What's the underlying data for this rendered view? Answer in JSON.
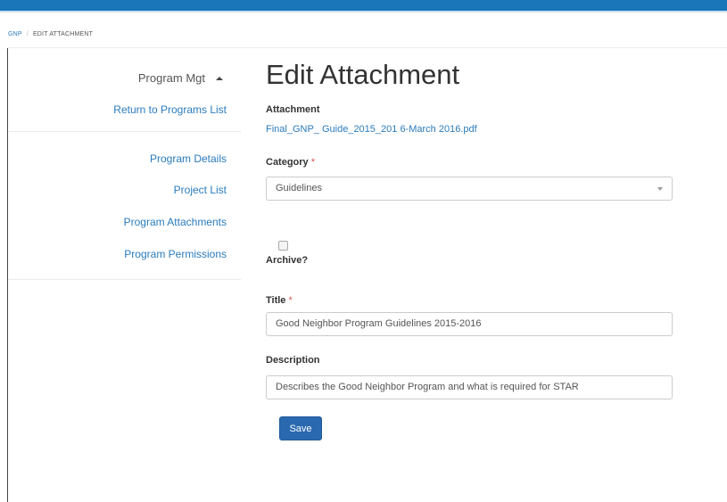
{
  "header": {
    "accent_color": "#1a76b8"
  },
  "breadcrumb": {
    "root": "GNP",
    "separator": "/",
    "current": "EDIT ATTACHMENT"
  },
  "sidebar": {
    "title": "Program Mgt",
    "return_link": "Return to Programs List",
    "items": [
      {
        "label": "Program Details"
      },
      {
        "label": "Project List"
      },
      {
        "label": "Program Attachments"
      },
      {
        "label": "Program Permissions"
      }
    ]
  },
  "form": {
    "page_title": "Edit Attachment",
    "attachment_label": "Attachment",
    "attachment_file": "Final_GNP_ Guide_2015_201 6-March 2016.pdf",
    "category_label": "Category",
    "category_value": "Guidelines",
    "required_marker": "*",
    "archive_label": "Archive?",
    "archive_checked": false,
    "title_label": "Title",
    "title_value": "Good Neighbor Program Guidelines 2015-2016",
    "description_label": "Description",
    "description_value": "Describes the Good Neighbor Program and what is required for STAR",
    "save_label": "Save",
    "save_color": "#2a69b0"
  }
}
